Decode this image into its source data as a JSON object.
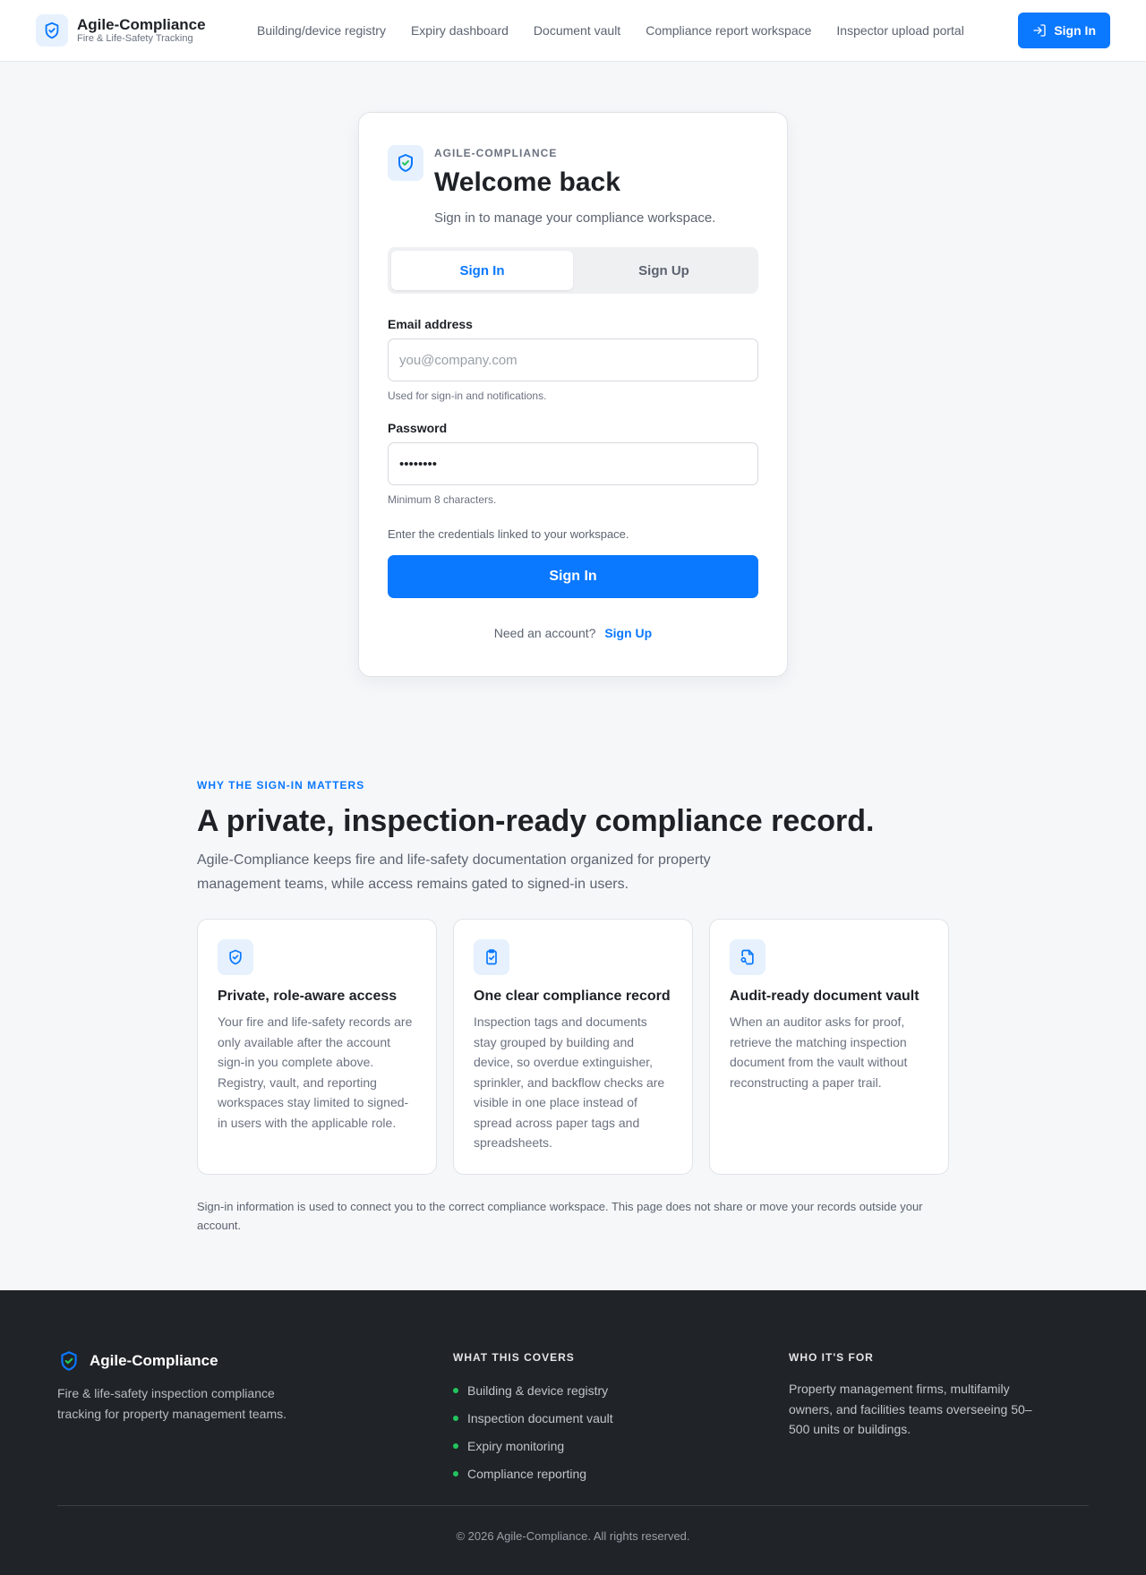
{
  "header": {
    "brand_name": "Agile-Compliance",
    "brand_tagline": "Fire & Life-Safety Tracking",
    "nav": [
      "Building/device registry",
      "Expiry dashboard",
      "Document vault",
      "Compliance report workspace",
      "Inspector upload portal"
    ],
    "signin_label": "Sign In"
  },
  "card": {
    "eyebrow": "AGILE-COMPLIANCE",
    "title": "Welcome back",
    "subtitle": "Sign in to manage your compliance workspace.",
    "tabs": [
      "Sign In",
      "Sign Up"
    ],
    "active_tab": "Sign In",
    "email_label": "Email address",
    "email_placeholder": "you@company.com",
    "email_hint": "Used for sign-in and notifications.",
    "password_label": "Password",
    "password_value": "••••••••",
    "password_hint": "Minimum 8 characters.",
    "note": "Enter the credentials linked to your workspace.",
    "submit_label": "Sign In",
    "switch_prompt": "Need an account?",
    "switch_link": "Sign Up"
  },
  "why": {
    "eyebrow": "WHY THE SIGN-IN MATTERS",
    "title": "A private, inspection-ready compliance record.",
    "lede": "Agile-Compliance keeps fire and life-safety documentation organized for property management teams, while access remains gated to signed-in users.",
    "features": [
      {
        "icon": "shield-check-icon",
        "title": "Private, role-aware access",
        "body": "Your fire and life-safety records are only available after the account sign-in you complete above. Registry, vault, and reporting workspaces stay limited to signed-in users with the applicable role."
      },
      {
        "icon": "clipboard-check-icon",
        "title": "One clear compliance record",
        "body": "Inspection tags and documents stay grouped by building and device, so overdue extinguisher, sprinkler, and backflow checks are visible in one place instead of spread across paper tags and spreadsheets."
      },
      {
        "icon": "file-search-icon",
        "title": "Audit-ready document vault",
        "body": "When an auditor asks for proof, retrieve the matching inspection document from the vault without reconstructing a paper trail."
      }
    ],
    "privacy": "Sign-in information is used to connect you to the correct compliance workspace. This page does not share or move your records outside your account."
  },
  "footer": {
    "brand_name": "Agile-Compliance",
    "description": "Fire & life-safety inspection compliance tracking for property management teams.",
    "covers_heading": "WHAT THIS COVERS",
    "covers": [
      "Building & device registry",
      "Inspection document vault",
      "Expiry monitoring",
      "Compliance reporting"
    ],
    "who_heading": "WHO IT'S FOR",
    "who_body": "Property management firms, multifamily owners, and facilities teams overseeing 50–500 units or buildings.",
    "copyright": "© 2026 Agile-Compliance. All rights reserved."
  },
  "colors": {
    "accent": "#0a78ff",
    "check_green": "#22c55e",
    "footer_bg": "#202327"
  }
}
